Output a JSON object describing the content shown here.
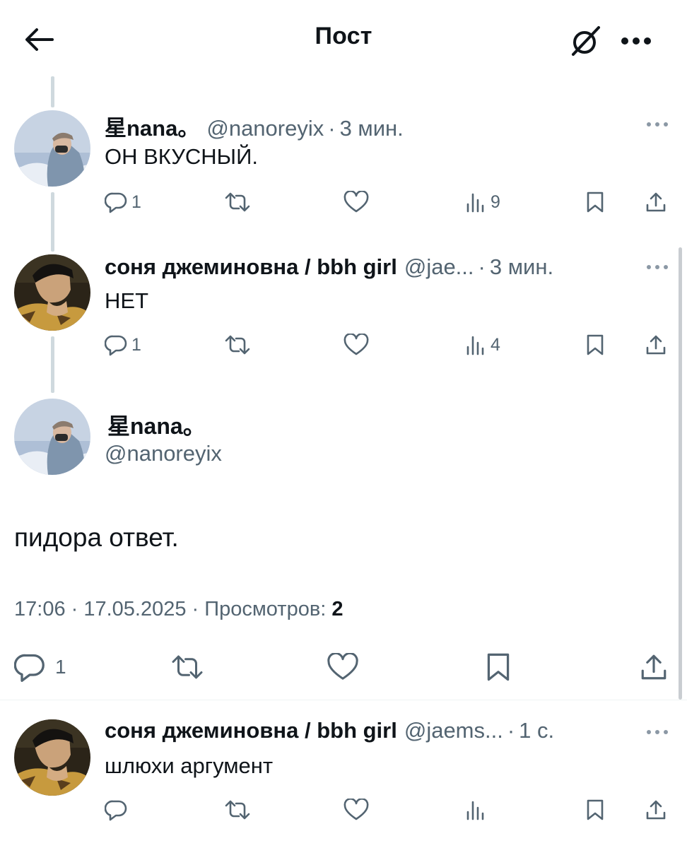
{
  "header": {
    "title": "Пост"
  },
  "icons": {
    "back": "arrow-left-icon",
    "grok": "grok-icon",
    "more": "more-horizontal-icon",
    "reply": "reply-icon",
    "retweet": "retweet-icon",
    "like": "heart-icon",
    "views": "views-icon",
    "bookmark": "bookmark-icon",
    "share": "share-icon"
  },
  "colors": {
    "text": "#0f1419",
    "secondary": "#536471",
    "thread_line": "#cfd9de"
  },
  "tweets": [
    {
      "name": "星nana。",
      "handle": "@nanoreyix",
      "time": "3 мин.",
      "text": "ОН ВКУСНЫЙ.",
      "replies": "1",
      "views": "9"
    },
    {
      "name": "соня джеминовна / bbh girl",
      "handle": "@jae...",
      "time": "3 мин.",
      "text": "НЕТ",
      "replies": "1",
      "views": "4"
    }
  ],
  "main_tweet": {
    "name": "星nana。",
    "handle": "@nanoreyix",
    "text": "пидора ответ.",
    "meta_time": "17:06 · 17.05.2025 · Просмотров:",
    "meta_views": "2",
    "replies": "1"
  },
  "reply_tweet": {
    "name": "соня джеминовна / bbh girl",
    "handle": "@jaems...",
    "time": "1 с.",
    "text": "шлюхи аргумент"
  },
  "separator": "·"
}
